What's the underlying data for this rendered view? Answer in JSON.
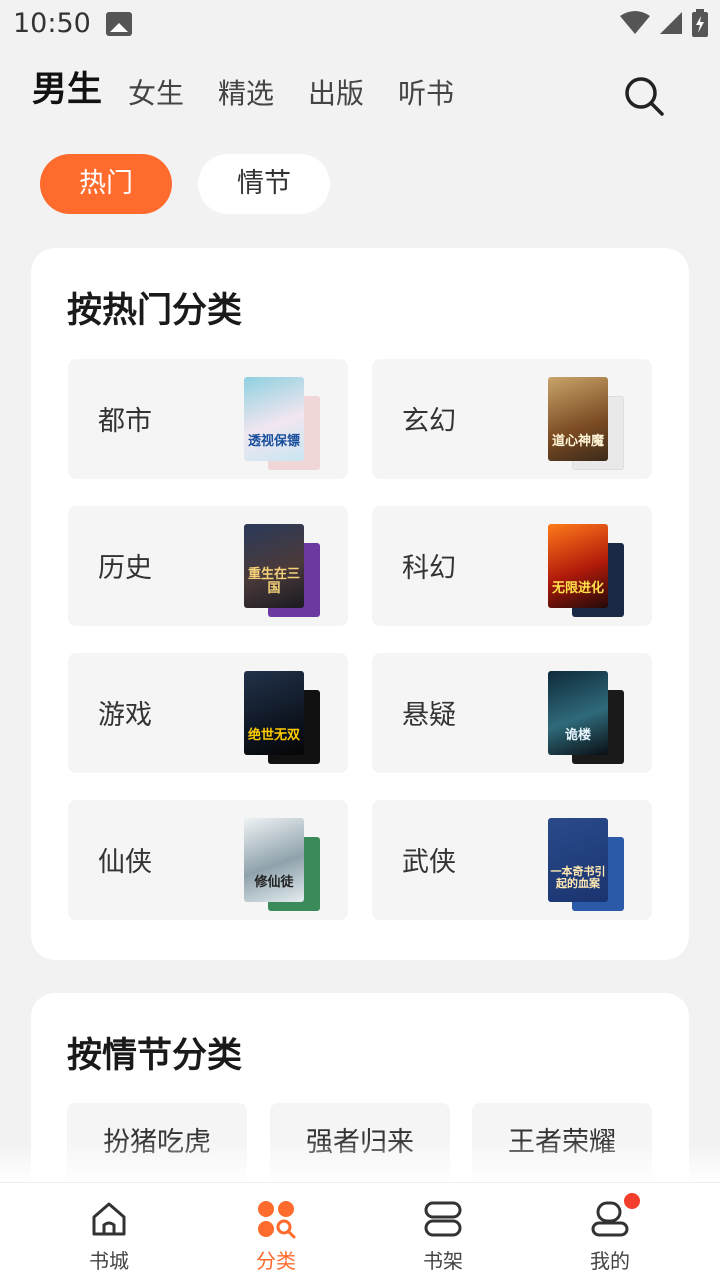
{
  "status": {
    "time": "10:50"
  },
  "top_tabs": [
    "男生",
    "女生",
    "精选",
    "出版",
    "听书"
  ],
  "sub_tabs": [
    "热门",
    "情节"
  ],
  "hot_section": {
    "title": "按热门分类",
    "categories": [
      {
        "label": "都市",
        "cover_text": "透视保镖"
      },
      {
        "label": "玄幻",
        "cover_text": "道心神魔"
      },
      {
        "label": "历史",
        "cover_text": "重生在三国"
      },
      {
        "label": "科幻",
        "cover_text": "无限进化"
      },
      {
        "label": "游戏",
        "cover_text": "绝世无双"
      },
      {
        "label": "悬疑",
        "cover_text": "诡楼"
      },
      {
        "label": "仙侠",
        "cover_text": "修仙徒"
      },
      {
        "label": "武侠",
        "cover_text": "一本奇书引起的血案"
      }
    ]
  },
  "plot_section": {
    "title": "按情节分类",
    "chips": [
      "扮猪吃虎",
      "强者归来",
      "王者荣耀"
    ]
  },
  "bottom_nav": [
    "书城",
    "分类",
    "书架",
    "我的"
  ],
  "colors": {
    "accent": "#ff6b2c",
    "badge": "#f33e2e"
  }
}
